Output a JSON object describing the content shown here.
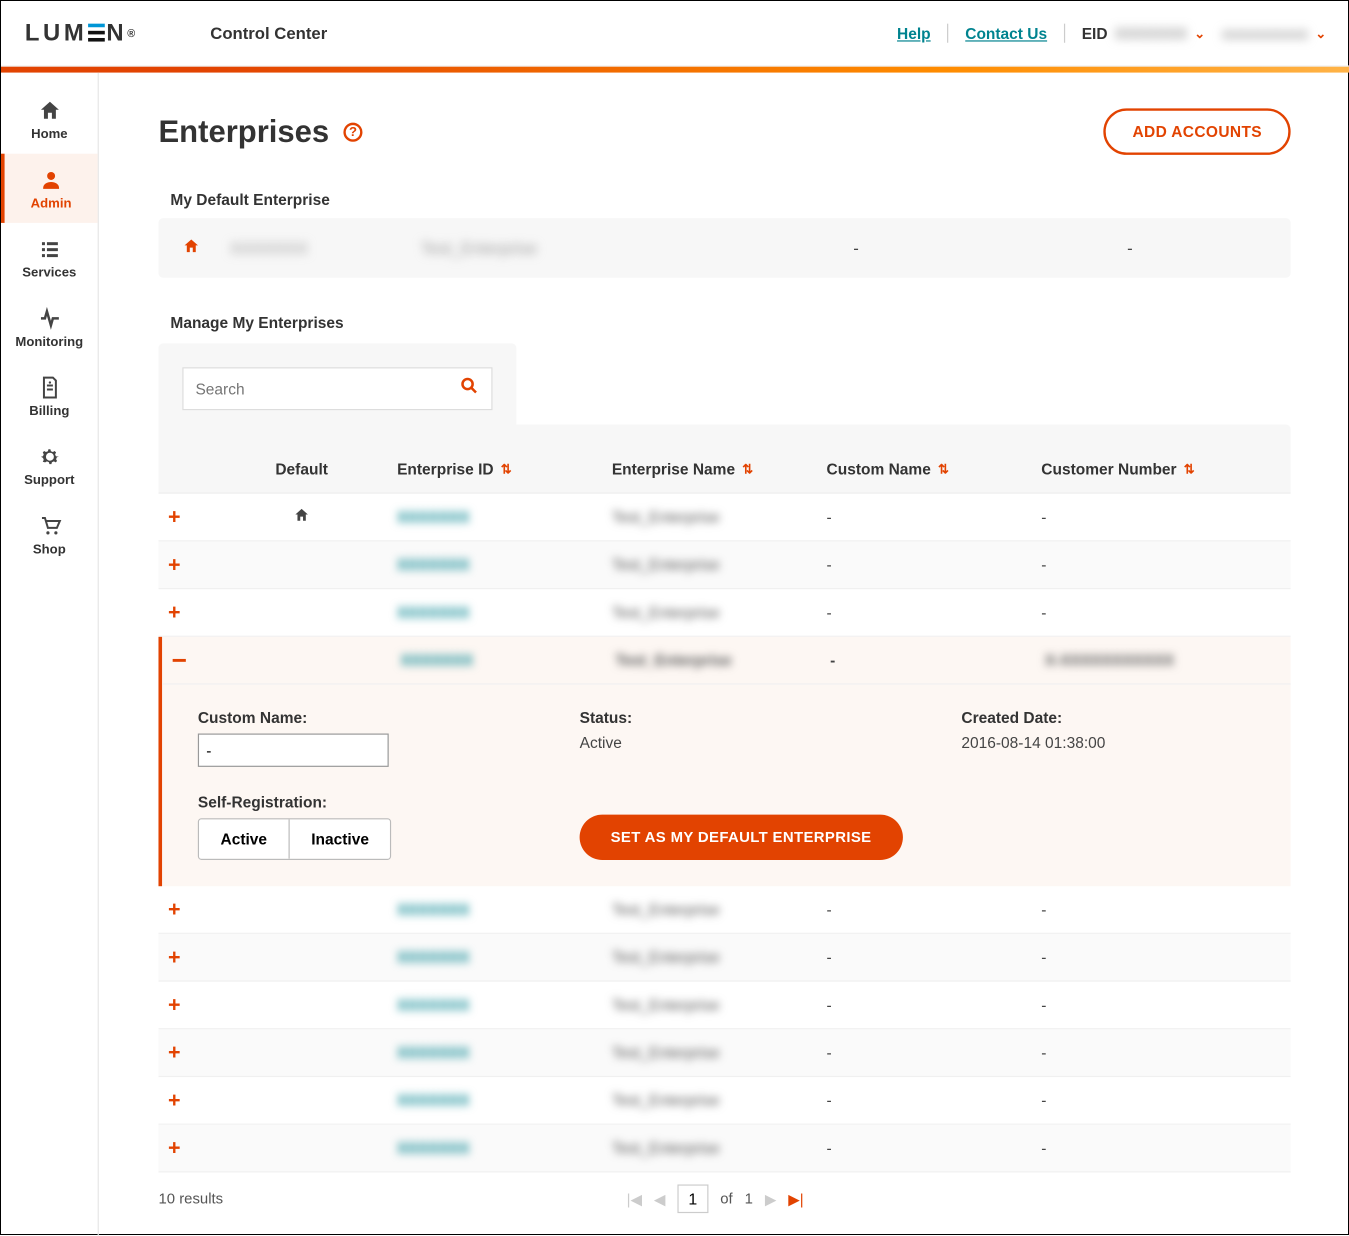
{
  "header": {
    "logo_text": "LUMEN",
    "app_name": "Control Center",
    "help": "Help",
    "contact": "Contact Us",
    "eid_label": "EID",
    "eid_value": "XXXXXXX",
    "user_name": "xxxxxxxxxx"
  },
  "sidebar": {
    "items": [
      "Home",
      "Admin",
      "Services",
      "Monitoring",
      "Billing",
      "Support",
      "Shop"
    ],
    "active_index": 1
  },
  "page": {
    "title": "Enterprises",
    "add_accounts_btn": "ADD ACCOUNTS",
    "section_default": "My Default Enterprise",
    "section_manage": "Manage My Enterprises",
    "search_placeholder": "Search"
  },
  "default_enterprise": {
    "id": "XXXXXXX",
    "name": "Test_Enterprise",
    "custom": "-",
    "customer": "-"
  },
  "columns": {
    "default": "Default",
    "enterprise_id": "Enterprise ID",
    "enterprise_name": "Enterprise Name",
    "custom_name": "Custom Name",
    "customer_number": "Customer Number"
  },
  "rows": [
    {
      "default": true,
      "id": "XXXXXXX",
      "name": "Test_Enterprise",
      "custom": "-",
      "customer": "-",
      "expanded": false
    },
    {
      "default": false,
      "id": "XXXXXXX",
      "name": "Test_Enterprise",
      "custom": "-",
      "customer": "-",
      "expanded": false
    },
    {
      "default": false,
      "id": "XXXXXXX",
      "name": "Test_Enterprise",
      "custom": "-",
      "customer": "-",
      "expanded": false
    },
    {
      "default": false,
      "id": "XXXXXXX",
      "name": "Test_Enterprise",
      "custom": "-",
      "customer": "X-XXXXXXXXXXX",
      "expanded": true
    },
    {
      "default": false,
      "id": "XXXXXXX",
      "name": "Test_Enterprise",
      "custom": "-",
      "customer": "-",
      "expanded": false
    },
    {
      "default": false,
      "id": "XXXXXXX",
      "name": "Test_Enterprise",
      "custom": "-",
      "customer": "-",
      "expanded": false
    },
    {
      "default": false,
      "id": "XXXXXXX",
      "name": "Test_Enterprise",
      "custom": "-",
      "customer": "-",
      "expanded": false
    },
    {
      "default": false,
      "id": "XXXXXXX",
      "name": "Test_Enterprise",
      "custom": "-",
      "customer": "-",
      "expanded": false
    },
    {
      "default": false,
      "id": "XXXXXXX",
      "name": "Test_Enterprise",
      "custom": "-",
      "customer": "-",
      "expanded": false
    },
    {
      "default": false,
      "id": "XXXXXXX",
      "name": "Test_Enterprise",
      "custom": "-",
      "customer": "-",
      "expanded": false
    }
  ],
  "expanded_panel": {
    "custom_name_label": "Custom Name:",
    "custom_name_value": "-",
    "status_label": "Status:",
    "status_value": "Active",
    "created_label": "Created Date:",
    "created_value": "2016-08-14 01:38:00",
    "selfreg_label": "Self-Registration:",
    "selfreg_active": "Active",
    "selfreg_inactive": "Inactive",
    "set_default_btn": "SET AS MY DEFAULT ENTERPRISE"
  },
  "pager": {
    "results": "10 results",
    "page": "1",
    "of": "of",
    "total": "1"
  }
}
